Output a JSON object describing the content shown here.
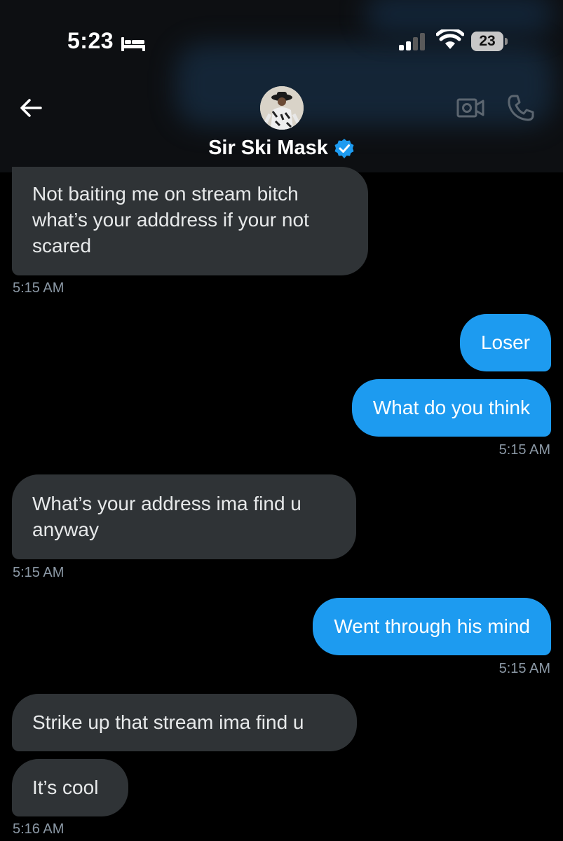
{
  "status_bar": {
    "time": "5:23",
    "battery": "23",
    "icons": [
      "bed-icon",
      "signal-icon",
      "wifi-icon",
      "battery-icon"
    ]
  },
  "header": {
    "contact_name": "Sir Ski Mask",
    "icons": [
      "back-arrow-icon",
      "avatar",
      "verified-badge-icon",
      "video-camera-icon",
      "phone-icon"
    ],
    "accent_color": "#1d9bf0"
  },
  "messages": [
    {
      "direction": "received",
      "text": "Not baiting me on stream bitch what’s your adddress if your not scared"
    },
    {
      "direction": "sent",
      "text": "Loser"
    },
    {
      "direction": "sent",
      "text": "What do you think"
    },
    {
      "direction": "received",
      "text": "What’s your address ima find u anyway"
    },
    {
      "direction": "sent",
      "text": "Went through his mind"
    },
    {
      "direction": "received",
      "text": "Strike up that stream ima find u"
    },
    {
      "direction": "received",
      "text": "It’s cool"
    }
  ],
  "timestamps": [
    "5:15 AM",
    "5:15 AM",
    "5:15 AM",
    "5:15 AM",
    "5:16 AM"
  ],
  "colors": {
    "received_bubble": "#2f3336",
    "sent_bubble": "#1d9bf0",
    "timestamp_text": "#8b98a5",
    "background": "#000000"
  }
}
